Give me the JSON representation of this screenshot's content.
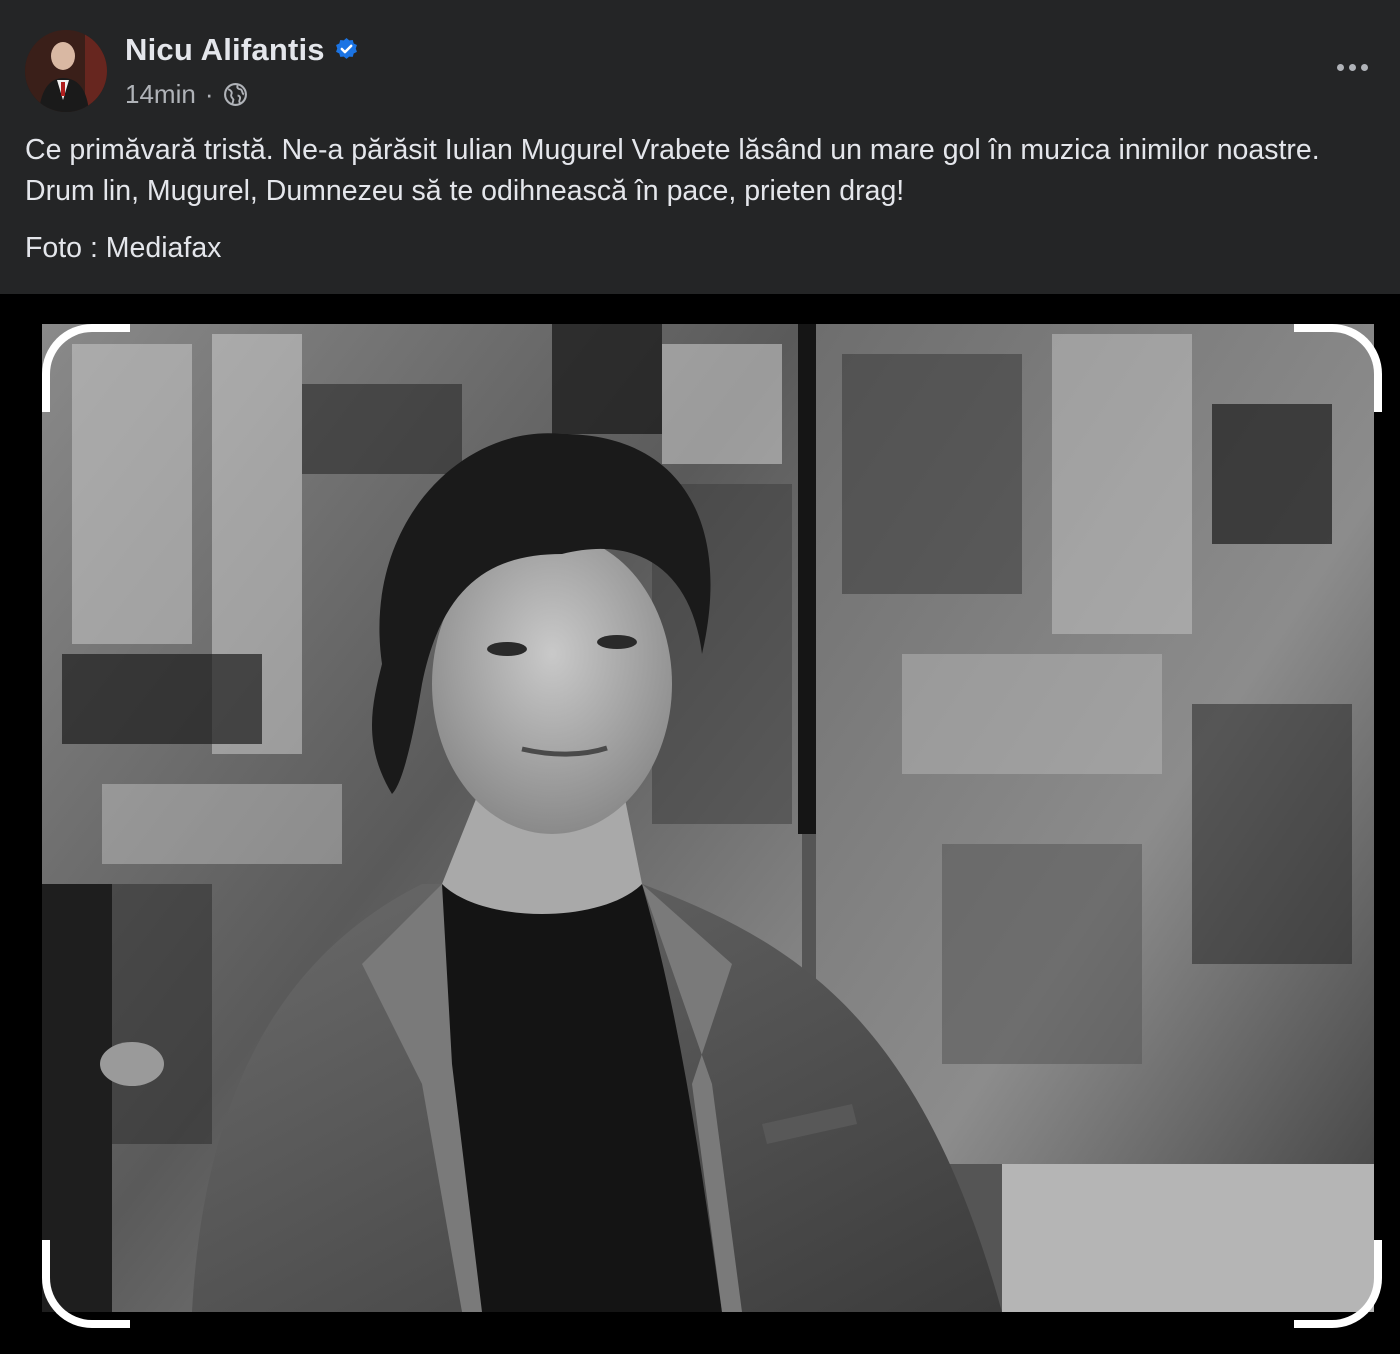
{
  "post": {
    "author": {
      "name": "Nicu Alifantis",
      "verified": true,
      "avatar_icon": "avatar-photo"
    },
    "time": "14min",
    "separator": "·",
    "privacy_icon": "globe-icon",
    "more_icon": "ellipsis-icon",
    "text": "Ce primăvară tristă. Ne-a părăsit Iulian Mugurel Vrabete lăsând un mare gol în muzica inimilor noastre. Drum lin, Mugurel, Dumnezeu să te odihnească în pace, prieten drag!",
    "credit": "Foto : Mediafax",
    "colors": {
      "card_background": "#242526",
      "primary_text": "#e4e6eb",
      "secondary_text": "#b0b3b8",
      "verified_badge": "#1b74e4"
    }
  },
  "photo": {
    "description_icon": "black-and-white-portrait-photo",
    "frame_icon": "scan-frame-corners"
  }
}
